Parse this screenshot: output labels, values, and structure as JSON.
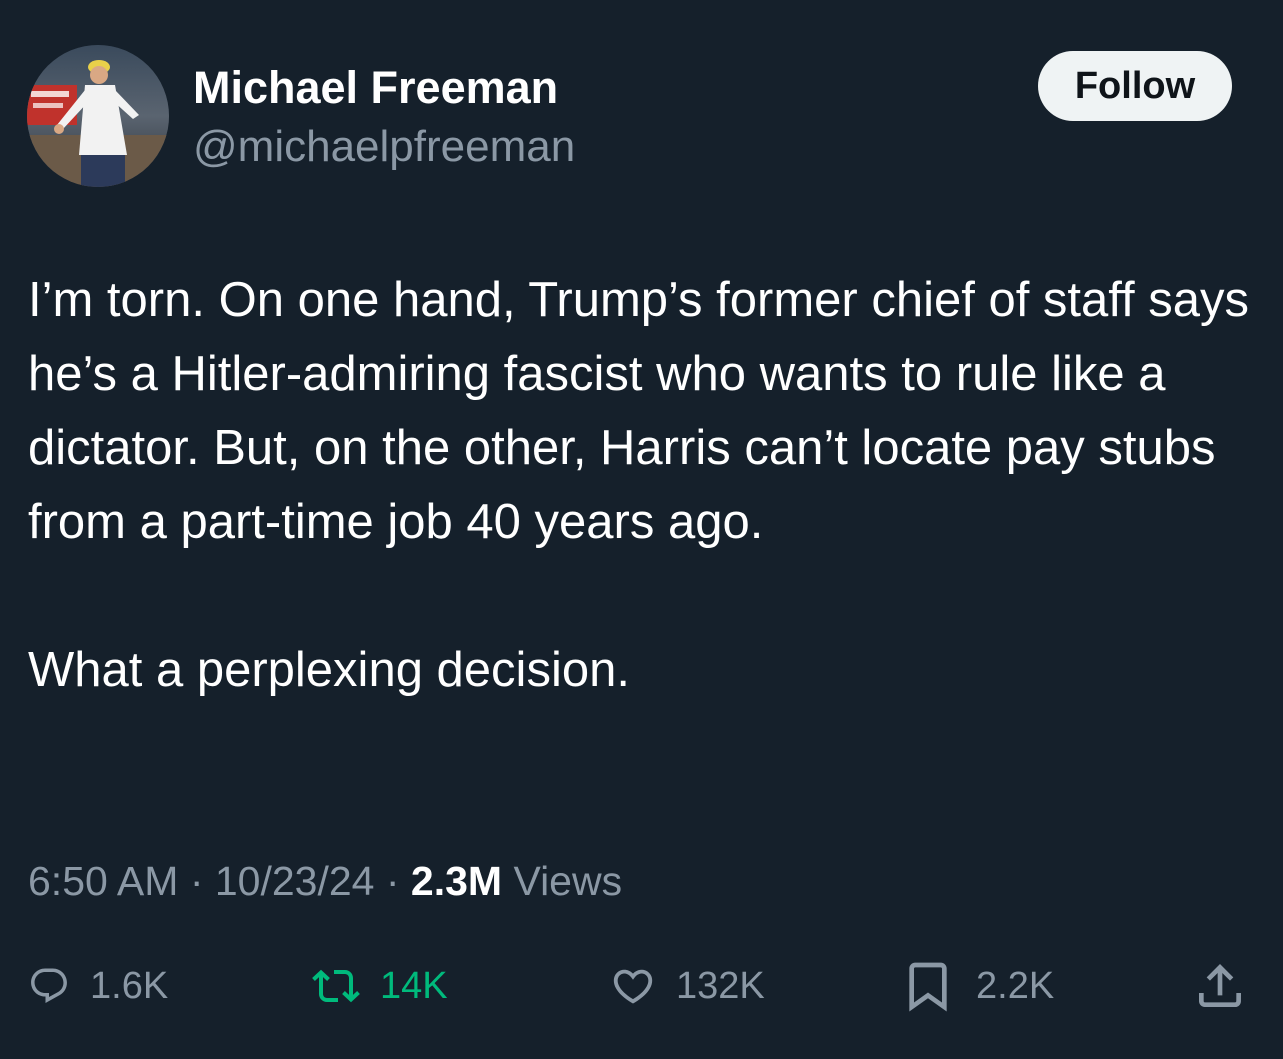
{
  "author": {
    "name": "Michael Freeman",
    "handle": "@michaelpfreeman"
  },
  "follow_button": {
    "label": "Follow"
  },
  "tweet": {
    "paragraph1": "I’m torn.  On one hand, Trump’s former chief of staff says he’s a Hitler-admiring fascist who wants to rule like a dictator.  But, on the other, Harris can’t locate pay stubs from a part-time job 40 years ago.",
    "paragraph2": "What a perplexing decision."
  },
  "meta": {
    "time": "6:50 AM",
    "separator1": " · ",
    "date": "10/23/24",
    "separator2": " · ",
    "views_count": "2.3M",
    "views_label": " Views"
  },
  "actions": {
    "reply": {
      "icon": "reply-icon",
      "count": "1.6K"
    },
    "retweet": {
      "icon": "retweet-icon",
      "count": "14K",
      "color": "#00ba7c"
    },
    "like": {
      "icon": "heart-icon",
      "count": "132K"
    },
    "bookmark": {
      "icon": "bookmark-icon",
      "count": "2.2K"
    },
    "share": {
      "icon": "share-icon"
    }
  },
  "colors": {
    "background": "#15202b",
    "text_primary": "#ffffff",
    "text_secondary": "#8b98a5",
    "follow_bg": "#eff3f4",
    "retweet_active": "#00ba7c"
  }
}
